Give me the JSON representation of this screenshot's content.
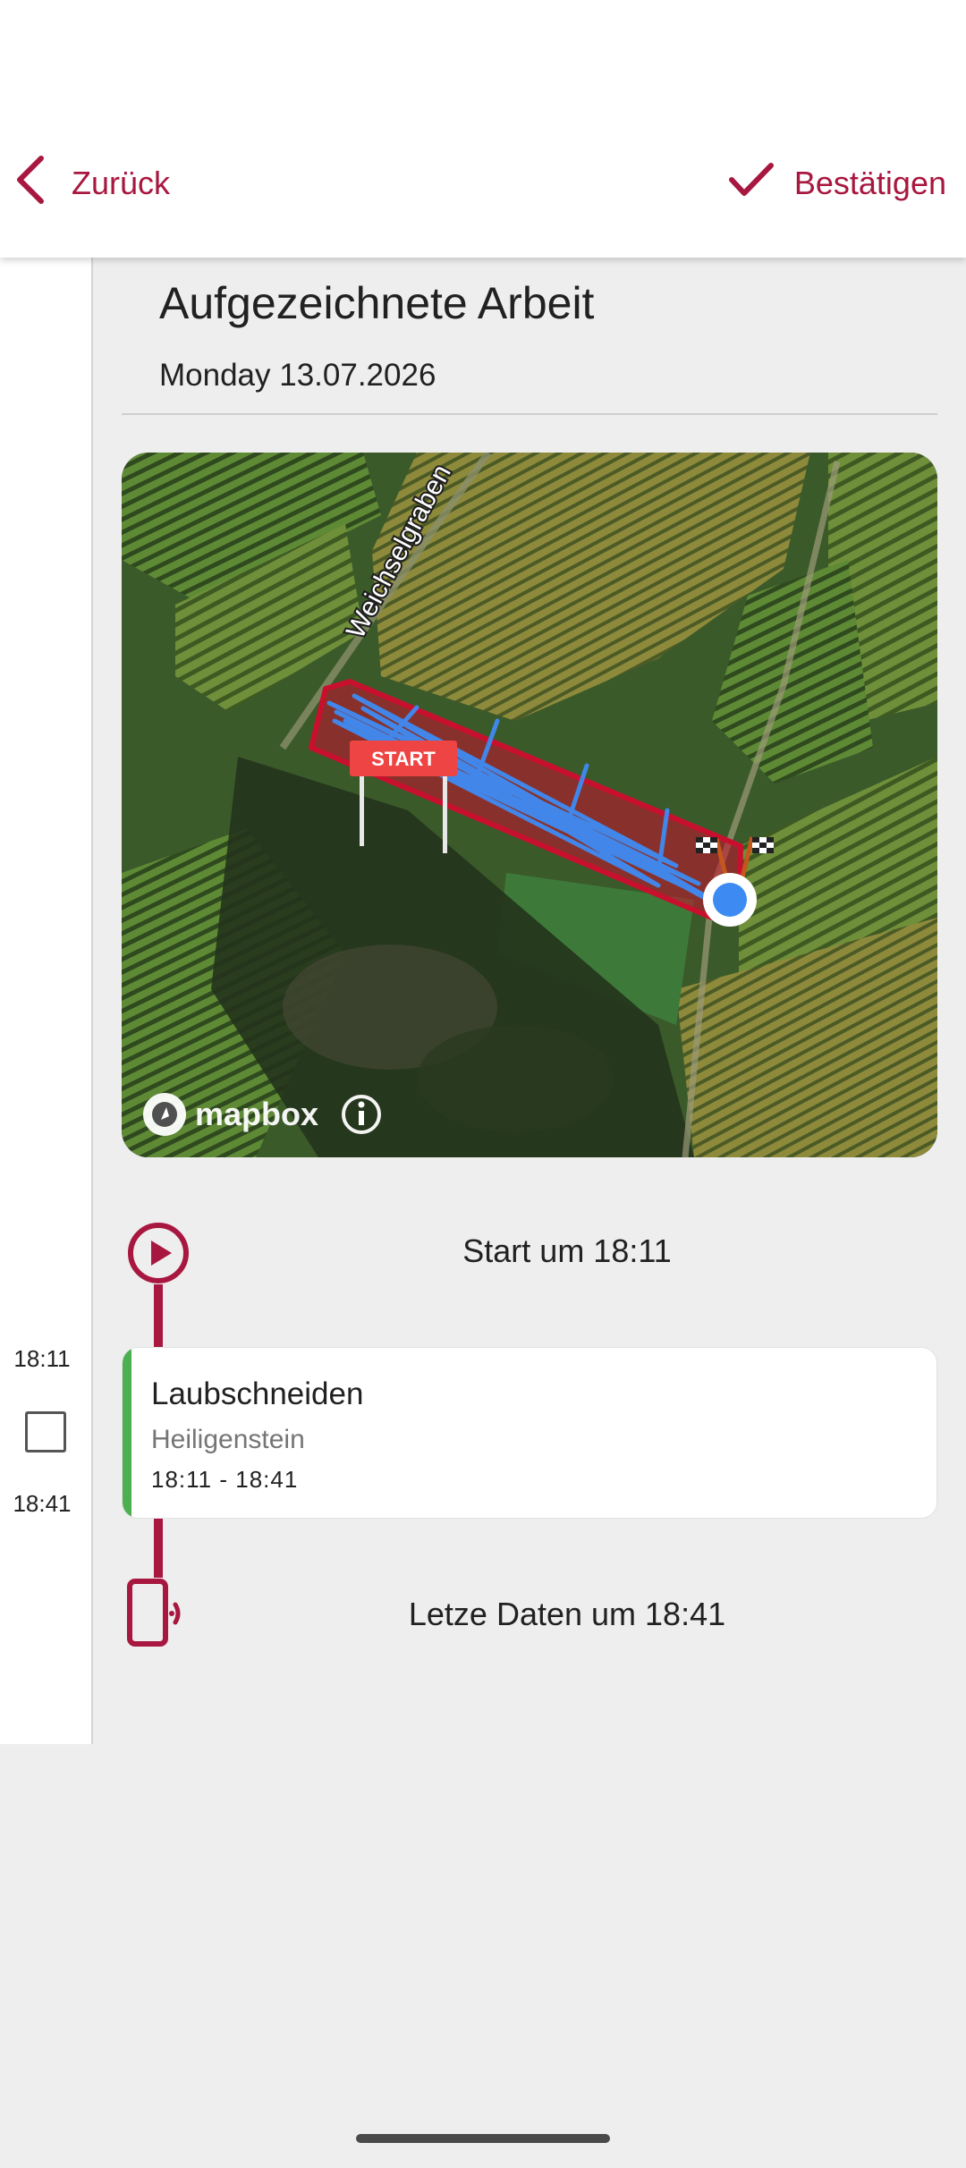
{
  "header": {
    "back_label": "Zurück",
    "confirm_label": "Bestätigen",
    "accent_color": "#a8173f"
  },
  "page": {
    "title": "Aufgezeichnete Arbeit",
    "date": "Monday 13.07.2026"
  },
  "map": {
    "road_label": "Weichselgraben",
    "start_flag_label": "START",
    "attribution": "mapbox",
    "track_color": "#3d8bf2",
    "area_color": "#c8102e"
  },
  "timeline": {
    "start_text": "Start um 18:11",
    "last_text": "Letze Daten um 18:41",
    "left_times": [
      "18:11",
      "18:41"
    ]
  },
  "entry": {
    "title": "Laubschneiden",
    "location": "Heiligenstein",
    "time_range": "18:11 - 18:41",
    "accent_color": "#4caf50"
  }
}
